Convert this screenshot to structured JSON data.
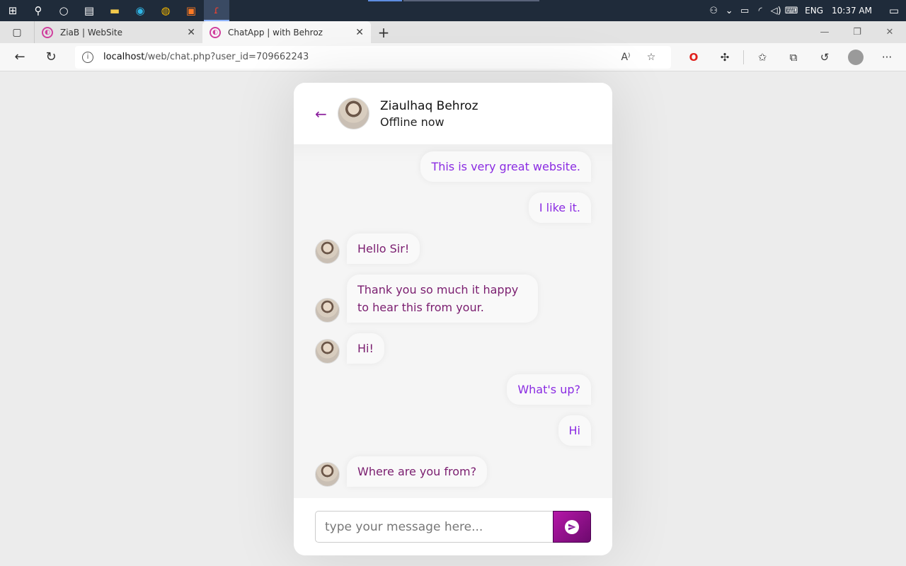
{
  "taskbar": {
    "lang": "ENG",
    "time": "10:37 AM"
  },
  "tabs": [
    {
      "title": "ZiaB | WebSite",
      "close": "✕"
    },
    {
      "title": "ChatApp | with Behroz",
      "close": "✕"
    }
  ],
  "address_bar": {
    "host": "localhost",
    "path": "/web/chat.php?user_id=709662243"
  },
  "chat": {
    "peer_name": "Ziaulhaq Behroz",
    "peer_status": "Offline now",
    "messages": [
      {
        "dir": "out",
        "text": "This is very great website."
      },
      {
        "dir": "out",
        "text": "I like it."
      },
      {
        "dir": "in",
        "text": "Hello Sir!"
      },
      {
        "dir": "in",
        "text": "Thank you so much it happy to hear this from your."
      },
      {
        "dir": "in",
        "text": "Hi!"
      },
      {
        "dir": "out",
        "text": "What's up?"
      },
      {
        "dir": "out",
        "text": "Hi"
      },
      {
        "dir": "in",
        "text": "Where are you from?"
      }
    ],
    "input_placeholder": "type your message here...",
    "accent_color": "#8a1d9c"
  }
}
